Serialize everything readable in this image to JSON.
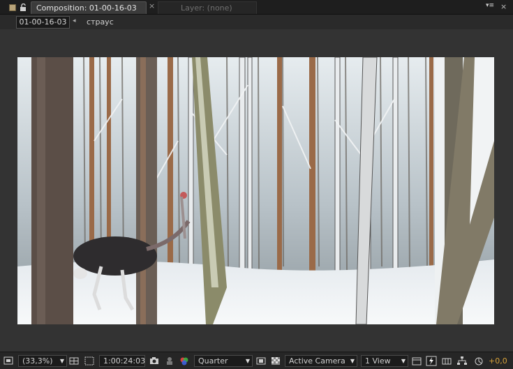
{
  "tabs": {
    "active": {
      "label": "Composition: 01-00-16-03",
      "menu_glyph": "▼",
      "close_glyph": "×"
    },
    "inactive": {
      "label": "Layer: (none)"
    },
    "panel_menu_glyph": "▾≡",
    "panel_close_glyph": "×",
    "label_color": "#b9a47a"
  },
  "breadcrumb": {
    "current": "01-00-16-03",
    "arrow": "◂",
    "parent": "страус"
  },
  "toolbar": {
    "magnification": "(33,3%)",
    "timecode": "1:00:24:03",
    "resolution": "Quarter",
    "camera": "Active Camera",
    "views": "1 View",
    "exposure": "+0,0",
    "exposure_color": "#d8a23a"
  }
}
